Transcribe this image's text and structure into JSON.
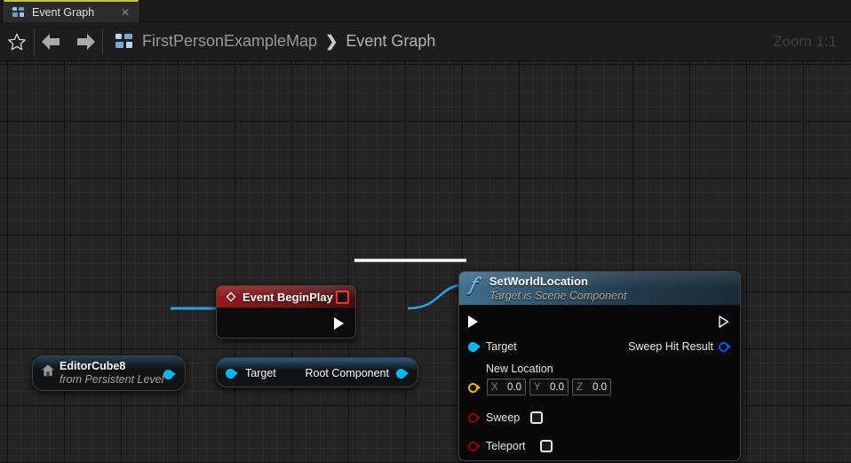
{
  "window": {
    "tab": {
      "label": "Event Graph",
      "icon": "blueprint-graph-icon",
      "close_icon": "close-icon"
    }
  },
  "toolbar": {
    "favorite_icon": "star-icon",
    "back_icon": "arrow-left-icon",
    "forward_icon": "arrow-right-icon",
    "breadcrumb_icon": "blueprint-graph-icon",
    "breadcrumb": [
      {
        "label": "FirstPersonExampleMap"
      },
      {
        "label": "Event Graph"
      }
    ],
    "separator": "❯",
    "zoom_label": "Zoom 1:1"
  },
  "graph": {
    "nodes": {
      "event_begin_play": {
        "title": "Event BeginPlay",
        "icon": "event-diamond-icon",
        "delegate_pin": "delegate-output-pin",
        "exec_out": "exec-output-pin"
      },
      "get_root_component": {
        "input_label": "Target",
        "output_label": "Root Component",
        "input_pin": "object-input-pin",
        "output_pin": "object-output-pin"
      },
      "editor_cube": {
        "title": "EditorCube8",
        "subtitle": "from Persistent Level",
        "icon": "level-actor-home-icon",
        "output_pin": "object-output-pin"
      },
      "set_world_location": {
        "title": "SetWorldLocation",
        "subtitle": "Target is Scene Component",
        "icon": "function-f-icon",
        "exec_in": "exec-input-pin",
        "exec_out": "exec-output-pin",
        "inputs": [
          {
            "label": "Target",
            "pin": "object-input-pin"
          },
          {
            "label": "New Location",
            "pin": "vector-input-pin"
          },
          {
            "label": "Sweep",
            "pin": "bool-input-pin",
            "checked": false
          },
          {
            "label": "Teleport",
            "pin": "bool-input-pin",
            "checked": false
          }
        ],
        "outputs": [
          {
            "label": "Sweep Hit Result",
            "pin": "struct-output-pin"
          }
        ],
        "new_location": {
          "x": {
            "axis": "X",
            "value": "0.0"
          },
          "y": {
            "axis": "Y",
            "value": "0.0"
          },
          "z": {
            "axis": "Z",
            "value": "0.0"
          }
        }
      }
    }
  },
  "colors": {
    "exec_wire": "#ffffff",
    "object_wire": "#2b9fe0",
    "exec_pin": "#ffffff",
    "object_pin": "#00b8f0",
    "vector_pin": "#e8b400",
    "bool_pin": "#8b0000",
    "struct_pin": "#0055e0",
    "event_header": "#8f1a1a",
    "function_header": "#41708c",
    "tab_accent": "#c8c040"
  }
}
